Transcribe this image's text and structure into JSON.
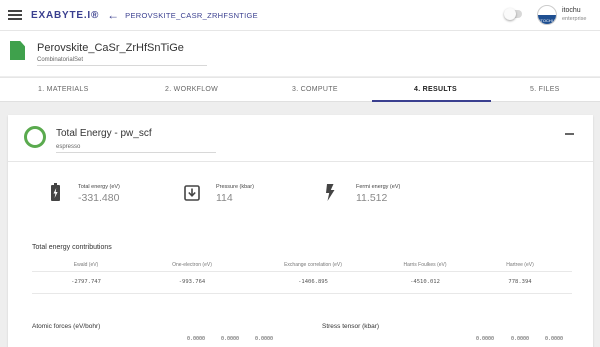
{
  "topbar": {
    "logo": "EXABYTE.I®",
    "breadcrumb": "PEROVSKITE_CASR_ZRHFSNTIGE",
    "user_name": "itochu",
    "user_role": "enterprise",
    "avatar_text": "ITOCHU"
  },
  "job": {
    "title": "Perovskite_CaSr_ZrHfSnTiGe",
    "subtitle": "CombinatorialSet"
  },
  "tabs": [
    "1. MATERIALS",
    "2. WORKFLOW",
    "3. COMPUTE",
    "4. RESULTS",
    "5. FILES"
  ],
  "active_tab_index": 3,
  "result": {
    "title": "Total Energy - pw_scf",
    "subtitle": "espresso",
    "metrics": [
      {
        "icon": "battery-icon",
        "label": "Total energy (eV)",
        "value": "-331.480"
      },
      {
        "icon": "pressure-download-icon",
        "label": "Pressure (kbar)",
        "value": "114"
      },
      {
        "icon": "lightning-bolt-icon",
        "label": "Fermi energy (eV)",
        "value": "11.512"
      }
    ],
    "contributions": {
      "heading": "Total energy contributions",
      "columns": [
        "Ewald (eV)",
        "One-electron (eV)",
        "Exchange correlation (eV)",
        "Harris Foulkes (eV)",
        "Hartree (eV)"
      ],
      "values": [
        "-2797.747",
        "-993.764",
        "-1406.895",
        "-4510.012",
        "778.394"
      ]
    },
    "forces": {
      "heading": "Atomic forces (eV/bohr)",
      "values": [
        "0.0000",
        "0.0000",
        "0.0000"
      ]
    },
    "stress": {
      "heading": "Stress tensor (kbar)",
      "values": [
        "0.0000",
        "0.0000",
        "0.0000"
      ]
    }
  },
  "colors": {
    "brand": "#3a3f8f",
    "success_ring": "#5aaa4e",
    "file_icon": "#3fa14c"
  }
}
